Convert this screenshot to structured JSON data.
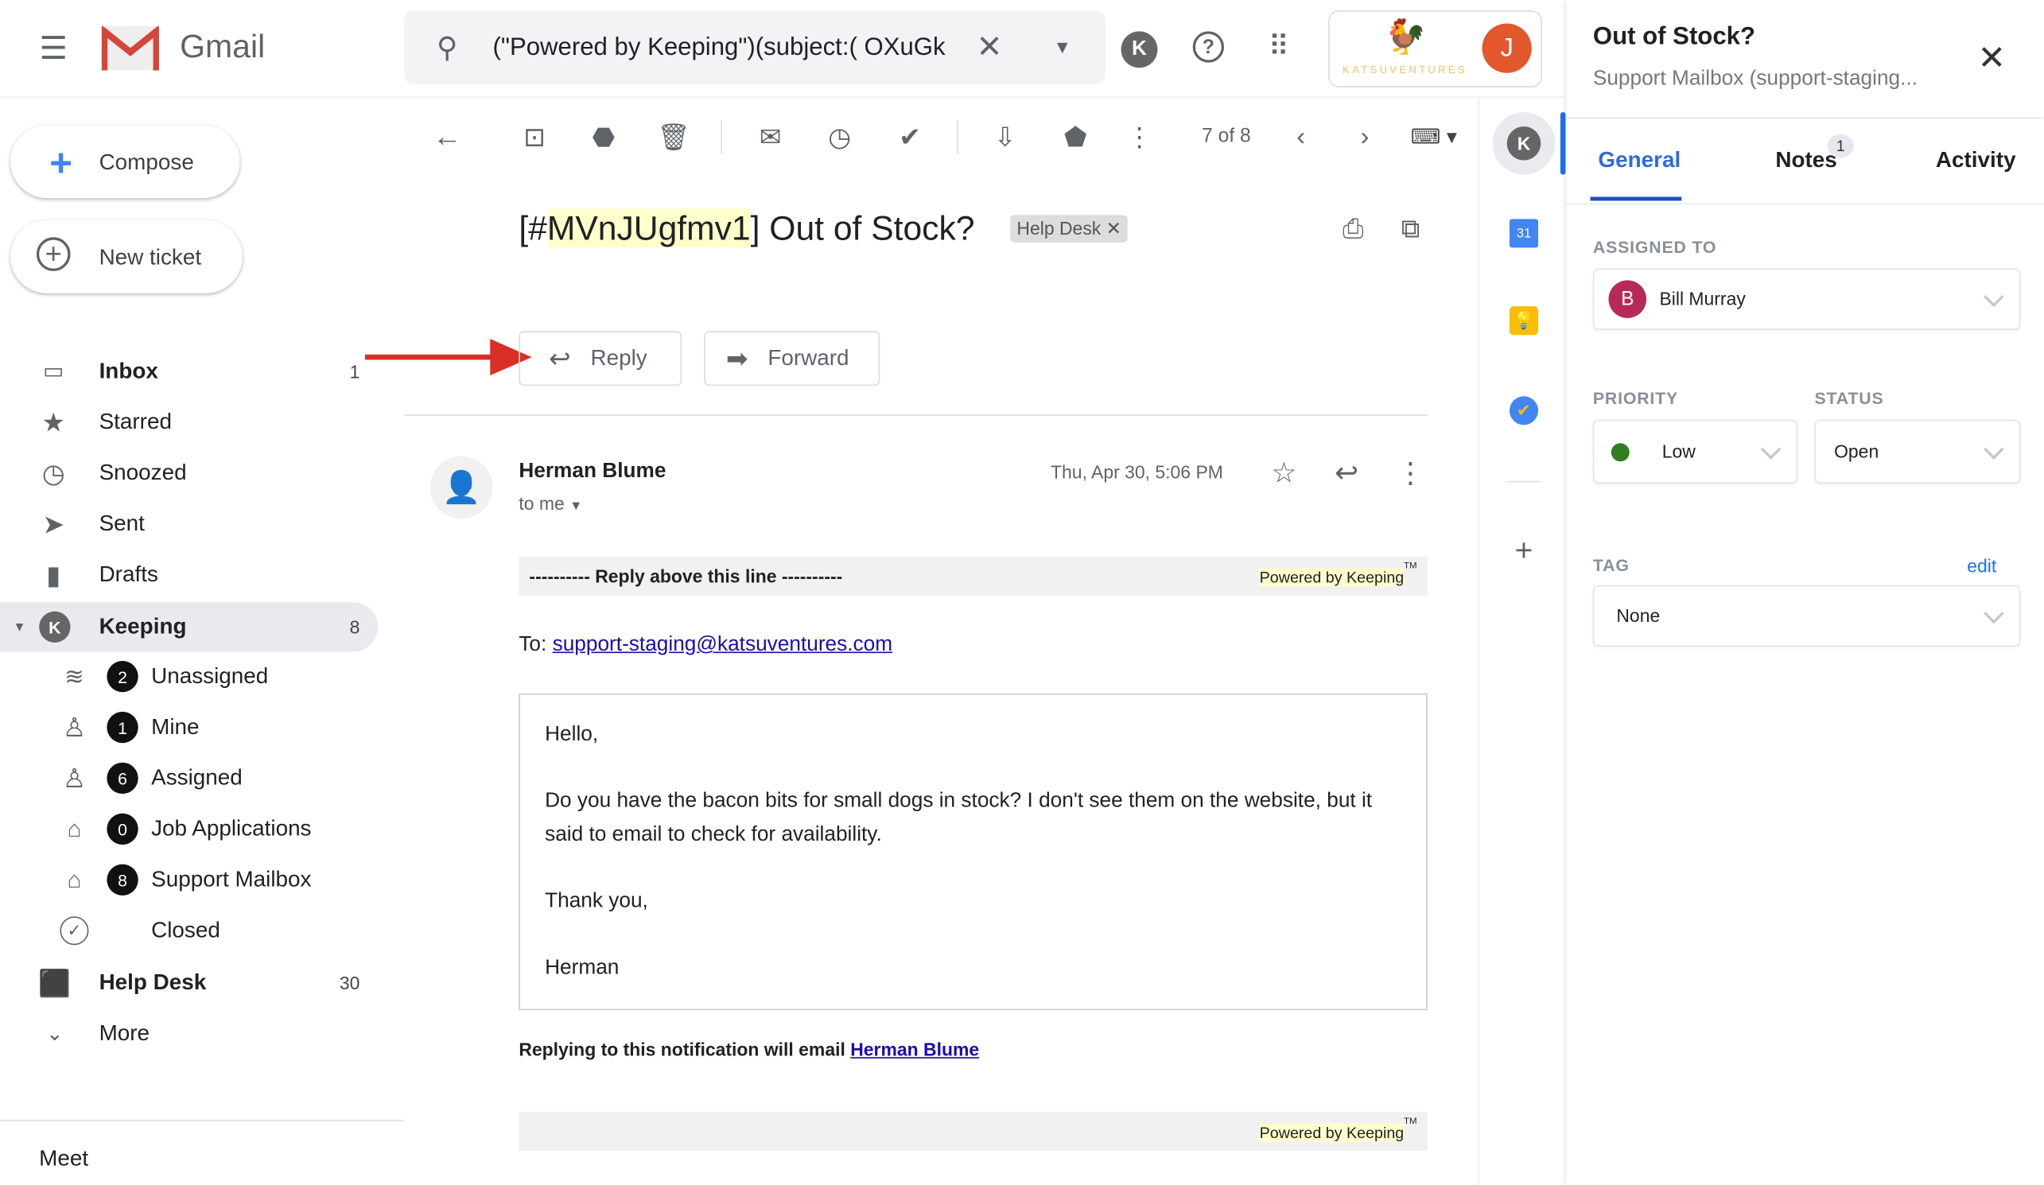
{
  "header": {
    "app_name": "Gmail",
    "search_query": "(\"Powered by Keeping\")(subject:( OXuGk",
    "brand_name": "KATSUVENTURES",
    "account_initial": "J"
  },
  "sidebar": {
    "compose": "Compose",
    "new_ticket": "New ticket",
    "items": [
      {
        "label": "Inbox",
        "count": "1",
        "icon": "inbox-icon"
      },
      {
        "label": "Starred",
        "icon": "star-icon"
      },
      {
        "label": "Snoozed",
        "icon": "clock-icon"
      },
      {
        "label": "Sent",
        "icon": "send-icon"
      },
      {
        "label": "Drafts",
        "icon": "draft-icon"
      },
      {
        "label": "Keeping",
        "count": "8",
        "icon": "keeping-icon"
      }
    ],
    "keeping_items": [
      {
        "label": "Unassigned",
        "count": "2",
        "icon": "layers-icon"
      },
      {
        "label": "Mine",
        "count": "1",
        "icon": "person-icon"
      },
      {
        "label": "Assigned",
        "count": "6",
        "icon": "person-check-icon"
      },
      {
        "label": "Job Applications",
        "count": "0",
        "icon": "inbox-tray-icon"
      },
      {
        "label": "Support Mailbox",
        "count": "8",
        "icon": "inbox-tray-icon"
      },
      {
        "label": "Closed",
        "icon": "check-circle-icon"
      }
    ],
    "help_desk": {
      "label": "Help Desk",
      "count": "30"
    },
    "more": "More",
    "meet": "Meet"
  },
  "toolbar": {
    "pagination": "7 of 8"
  },
  "email": {
    "subject_prefix": "[#",
    "ticket_id": "MVnJUgfmv1",
    "subject_suffix": "] Out of Stock?",
    "label_chip": "Help Desk",
    "reply": "Reply",
    "forward": "Forward",
    "sender": "Herman Blume",
    "to": "to me",
    "date": "Thu, Apr 30, 5:06 PM",
    "reply_line": "---------- Reply above this line ----------",
    "powered_by": "Powered by Keeping",
    "tm": "TM",
    "to_label": "To:",
    "to_address": "support-staging@katsuventures.com",
    "body": [
      "Hello,",
      "Do you have the bacon bits for small dogs in stock? I don't see them on the website, but it said to email to check for availability.",
      "Thank you,",
      "Herman"
    ],
    "replying_note": "Replying to this notification will email",
    "replying_name": "Herman Blume"
  },
  "panel": {
    "title": "Out of Stock?",
    "subtitle": "Support Mailbox (support-staging...",
    "tabs": [
      {
        "label": "General",
        "active": true
      },
      {
        "label": "Notes",
        "badge": "1"
      },
      {
        "label": "Activity"
      }
    ],
    "assigned_label": "ASSIGNED TO",
    "assignee_initial": "B",
    "assignee": "Bill Murray",
    "priority_label": "PRIORITY",
    "priority": "Low",
    "priority_color": "#2e7d1f",
    "status_label": "STATUS",
    "status": "Open",
    "tag_label": "TAG",
    "tag_edit": "edit",
    "tag": "None"
  },
  "colors": {
    "accent": "#1a73e8",
    "tab_active": "#2f6bd8",
    "avatar_j": "#e2572c",
    "avatar_b": "#b52a57",
    "arrow": "#d93025"
  }
}
